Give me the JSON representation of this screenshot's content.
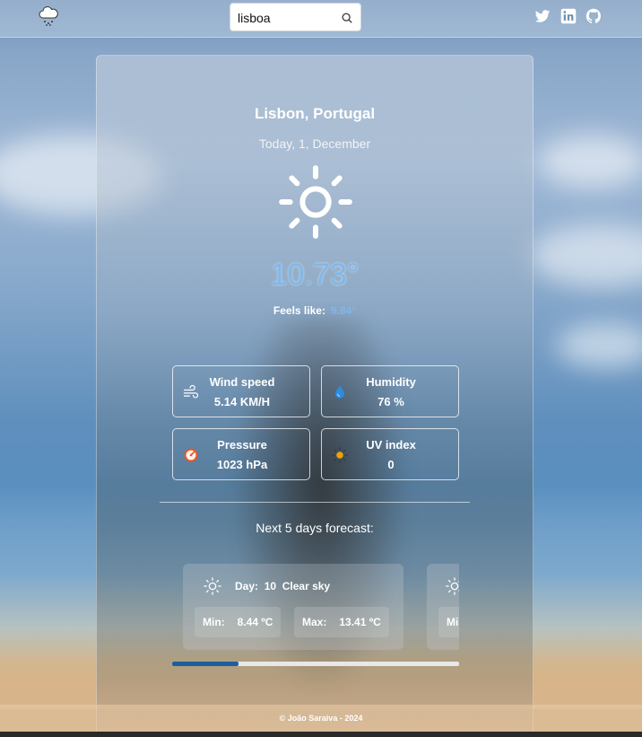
{
  "header": {
    "logo_icon": "cloud-snow-icon",
    "search": {
      "value": "lisboa",
      "placeholder": ""
    },
    "search_icon": "search-icon",
    "social": [
      "twitter-icon",
      "linkedin-icon",
      "github-icon"
    ]
  },
  "current": {
    "city": "Lisbon, Portugal",
    "date": "Today, 1, December",
    "weather_icon": "sun-icon",
    "temperature": "10.73°",
    "feels_like_label": "Feels like:",
    "feels_like_value": "9.84°"
  },
  "stats": [
    {
      "title": "Wind speed",
      "value": "5.14 KM/H",
      "icon": "wind-icon"
    },
    {
      "title": "Humidity",
      "value": "76 %",
      "icon": "water-drop-icon"
    },
    {
      "title": "Pressure",
      "value": "1023 hPa",
      "icon": "gauge-icon"
    },
    {
      "title": "UV index",
      "value": "0",
      "icon": "sun-icon"
    }
  ],
  "forecast": {
    "title": "Next 5 days forecast:",
    "days": [
      {
        "day_label": "Day:",
        "day": "10",
        "description": "Clear sky",
        "min_label": "Min:",
        "min": "8.44 ºC",
        "max_label": "Max:",
        "max": "13.41 ºC",
        "icon": "sun-icon"
      },
      {
        "min_label": "Mi",
        "icon": "sun-icon"
      }
    ],
    "scroll_position": 0.23
  },
  "footer": {
    "text": "© João Saraiva - 2024"
  },
  "colors": {
    "accent_temp": "#7eb7ec",
    "scroll_thumb": "#1d5f9c"
  }
}
